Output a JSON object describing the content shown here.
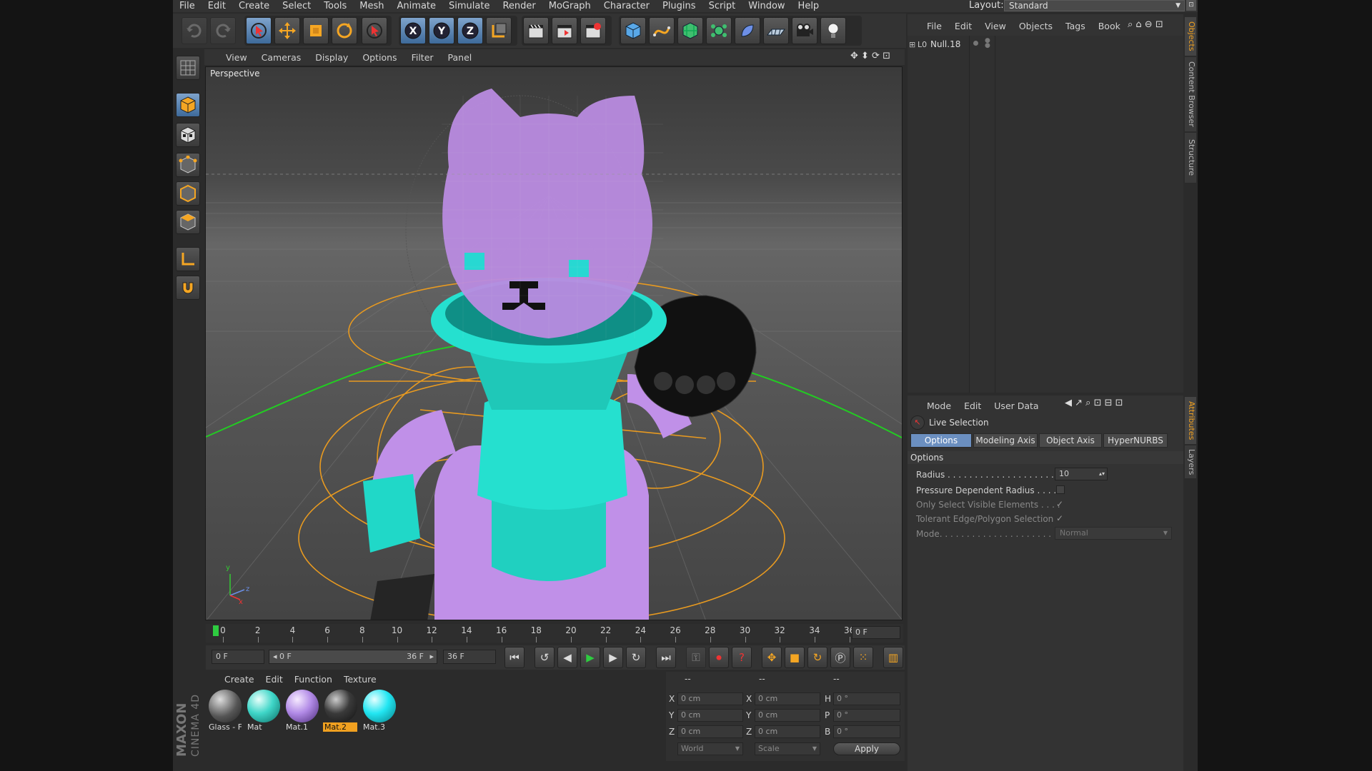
{
  "menu": [
    "File",
    "Edit",
    "Create",
    "Select",
    "Tools",
    "Mesh",
    "Animate",
    "Simulate",
    "Render",
    "MoGraph",
    "Character",
    "Plugins",
    "Script",
    "Window",
    "Help"
  ],
  "layout": {
    "label": "Layout:",
    "value": "Standard"
  },
  "viewport": {
    "menu": [
      "View",
      "Cameras",
      "Display",
      "Options",
      "Filter",
      "Panel"
    ],
    "title": "Perspective",
    "axis": {
      "x": "x",
      "y": "y",
      "z": "z"
    }
  },
  "timeline": {
    "ticks": [
      "0",
      "2",
      "4",
      "6",
      "8",
      "10",
      "12",
      "14",
      "16",
      "18",
      "20",
      "22",
      "24",
      "26",
      "28",
      "30",
      "32",
      "34",
      "36"
    ],
    "current": "0 F",
    "start": "0 F",
    "range_start": "0 F",
    "range_end": "36 F",
    "end": "36 F"
  },
  "materials": {
    "menu": [
      "Create",
      "Edit",
      "Function",
      "Texture"
    ],
    "items": [
      {
        "label": "Glass - F",
        "color": "#6a6a6a",
        "selected": false
      },
      {
        "label": "Mat",
        "color": "#3fd6c8",
        "selected": false
      },
      {
        "label": "Mat.1",
        "color": "#b18ae6",
        "selected": false
      },
      {
        "label": "Mat.2",
        "color": "#3a3a3a",
        "selected": true
      },
      {
        "label": "Mat.3",
        "color": "#22e6f2",
        "selected": false
      }
    ]
  },
  "coordinates": {
    "headers": [
      "--",
      "--",
      "--"
    ],
    "pos": {
      "x": "0 cm",
      "y": "0 cm",
      "z": "0 cm"
    },
    "size": {
      "x": "0 cm",
      "y": "0 cm",
      "z": "0 cm"
    },
    "rot": {
      "h": "0 °",
      "p": "0 °",
      "b": "0 °"
    },
    "labels": {
      "x": "X",
      "y": "Y",
      "z": "Z",
      "h": "H",
      "p": "P",
      "b": "B"
    },
    "mode1": "World",
    "mode2": "Scale",
    "apply": "Apply"
  },
  "objects": {
    "menu": [
      "File",
      "Edit",
      "View",
      "Objects",
      "Tags",
      "Book"
    ],
    "items": [
      {
        "name": "Null.18"
      }
    ]
  },
  "attributes": {
    "menu": [
      "Mode",
      "Edit",
      "User Data"
    ],
    "tool": "Live Selection",
    "tabs": [
      "Options",
      "Modeling Axis",
      "Object Axis",
      "HyperNURBS"
    ],
    "section": "Options",
    "rows": [
      {
        "label": "Radius . . . . . . . . . . . . . . . . . . . . . . . .",
        "value": "10"
      },
      {
        "label": "Pressure Dependent Radius . . . .",
        "value": ""
      },
      {
        "label": "Only Select Visible Elements . . . .",
        "value": "✓"
      },
      {
        "label": "Tolerant Edge/Polygon Selection",
        "value": "✓"
      },
      {
        "label": "Mode. . . . . . . . . . . . . . . . . . . . . . . . .",
        "value": "Normal"
      }
    ]
  },
  "side_tabs": {
    "top": [
      "Objects",
      "Content Browser",
      "Structure"
    ],
    "bottom": [
      "Attributes",
      "Layers"
    ]
  },
  "brand": {
    "name": "MAXON",
    "product": "CINEMA 4D"
  }
}
